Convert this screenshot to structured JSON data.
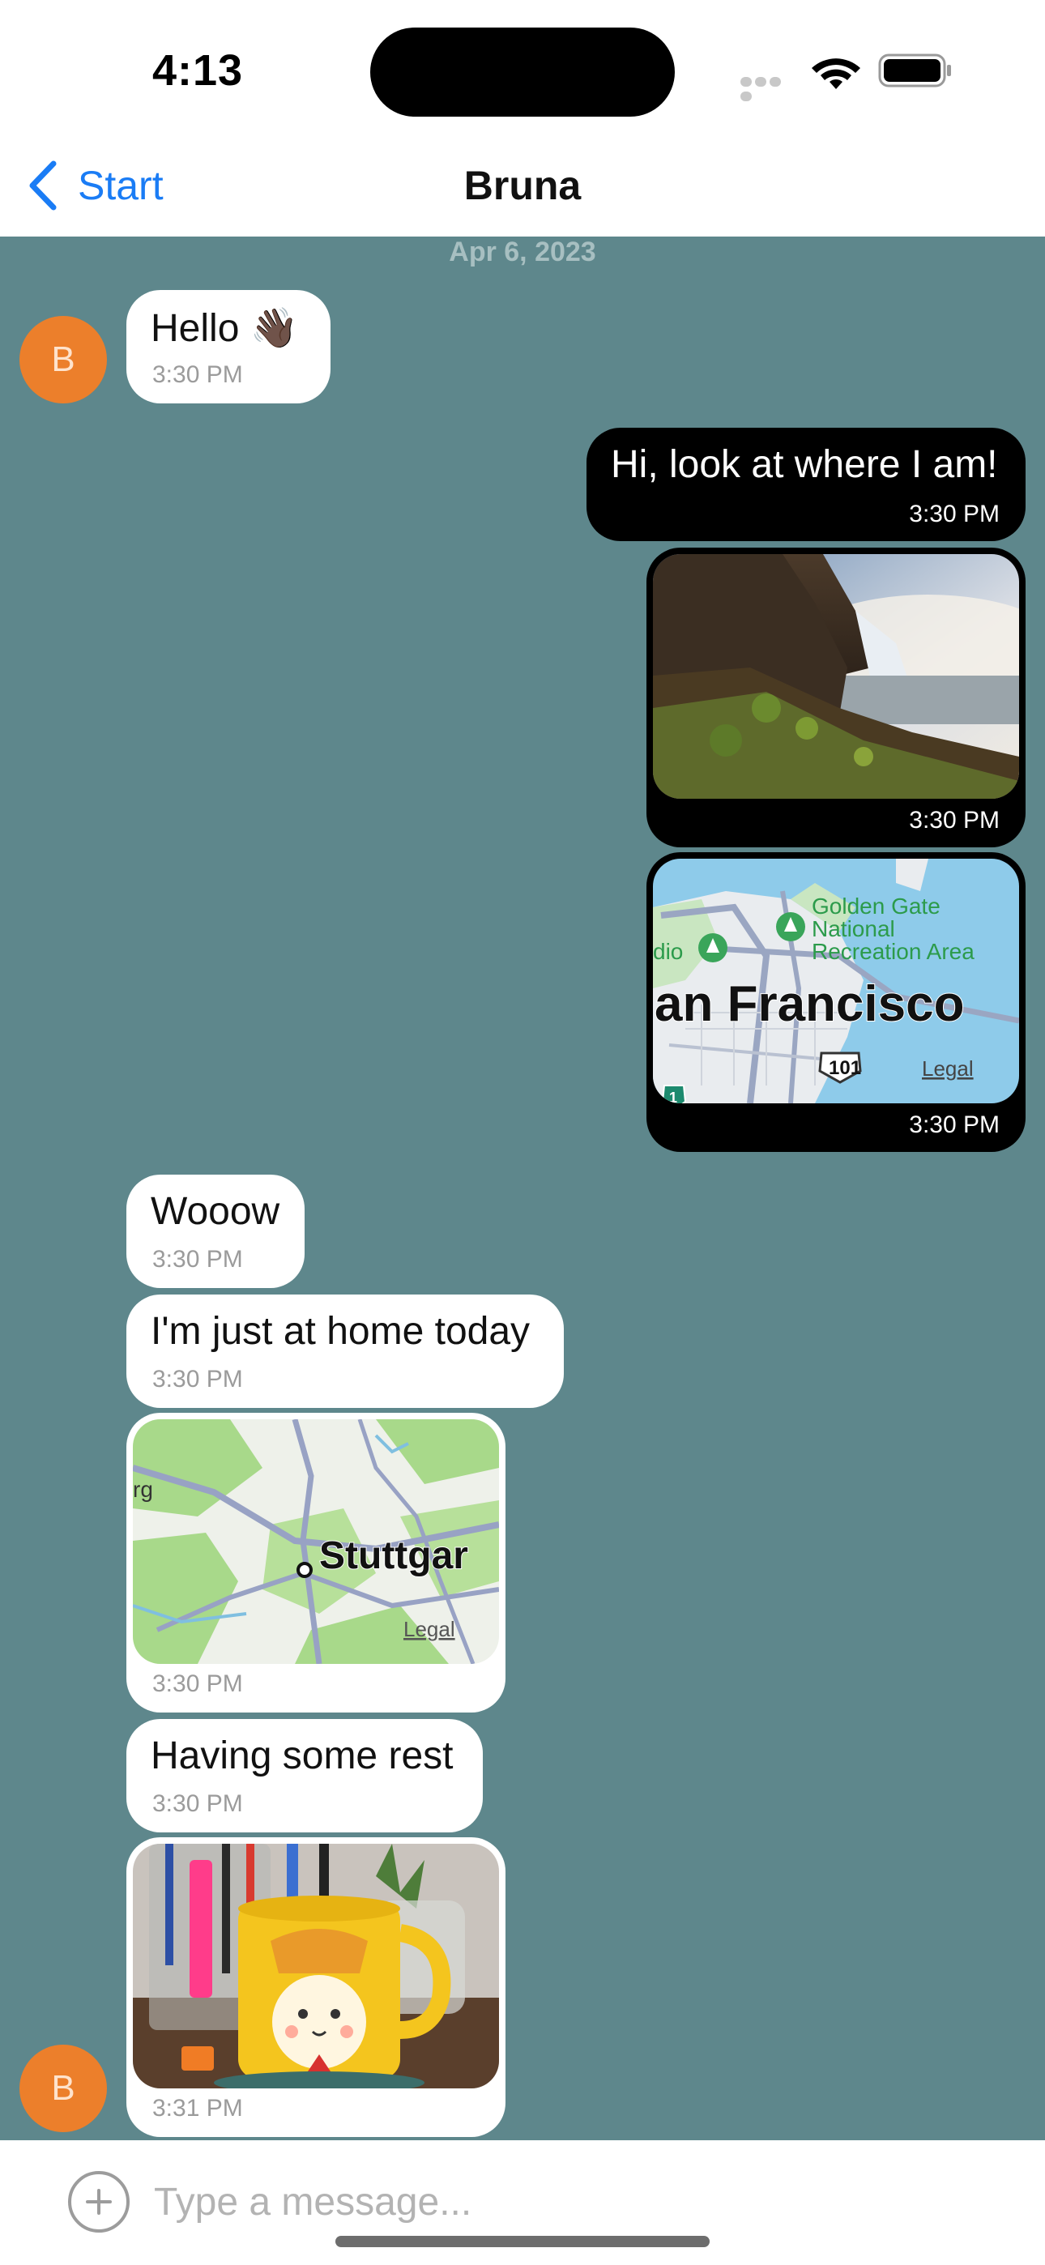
{
  "status_bar": {
    "time": "4:13"
  },
  "nav": {
    "back_label": "Start",
    "title": "Bruna"
  },
  "chat": {
    "date_separator": "Apr 6, 2023",
    "avatar_initial": "B",
    "messages": [
      {
        "direction": "incoming",
        "type": "text",
        "text": "Hello 👋🏿",
        "time": "3:30 PM"
      },
      {
        "direction": "outgoing",
        "type": "text",
        "text": "Hi, look at where I am!",
        "time": "3:30 PM"
      },
      {
        "direction": "outgoing",
        "type": "image",
        "time": "3:30 PM"
      },
      {
        "direction": "outgoing",
        "type": "map",
        "time": "3:30 PM",
        "map_labels": {
          "park_line1": "Golden Gate",
          "park_line2": "National",
          "park_line3": "Recreation Area",
          "left_fragment": "dio",
          "city": "an Francisco",
          "highway": "101",
          "route": "1",
          "legal": "Legal"
        }
      },
      {
        "direction": "incoming",
        "type": "text",
        "text": "Wooow",
        "time": "3:30 PM"
      },
      {
        "direction": "incoming",
        "type": "text",
        "text": "I'm just at home today",
        "time": "3:30 PM"
      },
      {
        "direction": "incoming",
        "type": "map",
        "time": "3:30 PM",
        "map_labels": {
          "left_fragment": "rg",
          "city": "Stuttgar",
          "legal": "Legal"
        }
      },
      {
        "direction": "incoming",
        "type": "text",
        "text": "Having some rest",
        "time": "3:30 PM"
      },
      {
        "direction": "incoming",
        "type": "image",
        "time": "3:31 PM"
      }
    ]
  },
  "composer": {
    "placeholder": "Type a message..."
  },
  "colors": {
    "chat_background": "#5e878c",
    "incoming_bubble": "#ffffff",
    "outgoing_bubble": "#000000",
    "avatar": "#ec7f2b",
    "accent": "#1a7cf5"
  }
}
